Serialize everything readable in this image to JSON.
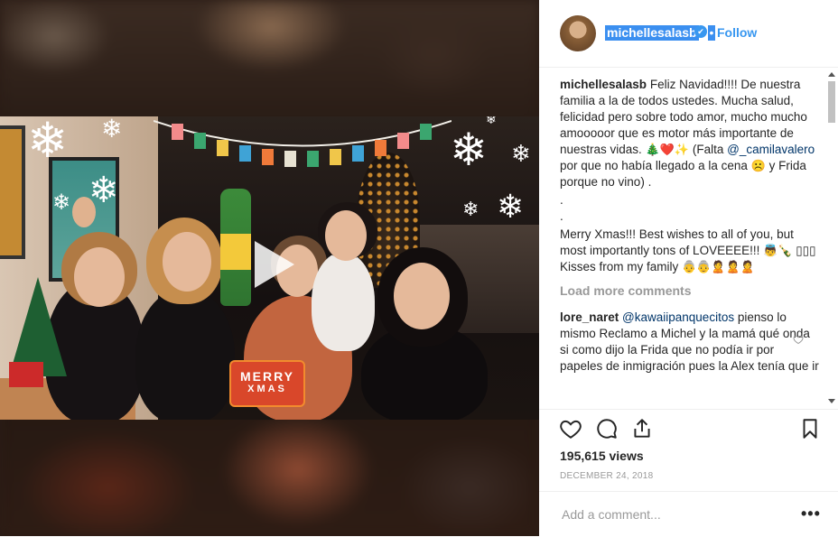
{
  "post": {
    "username": "michellesalasb",
    "follow_label": "Follow",
    "verified_glyph": "✔",
    "dot_glyph": "•"
  },
  "media": {
    "sticker_line1": "MERRY",
    "sticker_line2": "XMAS",
    "play_icon": "play-icon",
    "snow_glyph": "❄"
  },
  "caption": {
    "username": "michellesalasb",
    "text1": "Feliz Navidad!!!! De nuestra familia a la de todos ustedes. Mucha salud, felicidad pero sobre todo amor, mucho mucho amooooor que es motor más importante de nuestras vidas. ",
    "emojis1": "🎄❤️✨",
    "text2": " (Falta ",
    "mention": "@_camilavalero",
    "text3": " por que no había llegado a la cena ",
    "emoji2": "☹️",
    "text4": " y Frida porque no vino) .",
    "dot1": ".",
    "dot2": ".",
    "text5": "Merry Xmas!!! Best wishes to all of you, but most importantly tons of LOVEEEE!!! ",
    "emojis3": "👼🍾",
    "boxes": "▯▯▯",
    "text6": " Kisses from my family ",
    "emojis4": "👵👵🙎🙎🙎"
  },
  "load_more_label": "Load more comments",
  "comment": {
    "username": "lore_naret",
    "mention": "@kawaiipanquecitos",
    "text": " pienso lo mismo Reclamo a Michel y la mamá qué onda si como dijo la Frida que no podía ir por papeles de inmigración pues la Alex tenía que ir"
  },
  "stats": {
    "views": "195,615 views",
    "date": "DECEMBER 24, 2018"
  },
  "add_comment": {
    "placeholder": "Add a comment...",
    "more_label": "•••"
  },
  "colors": {
    "link_blue": "#3897f0",
    "selection_blue": "#3b8ff0",
    "text": "#262626",
    "muted": "#999999"
  }
}
